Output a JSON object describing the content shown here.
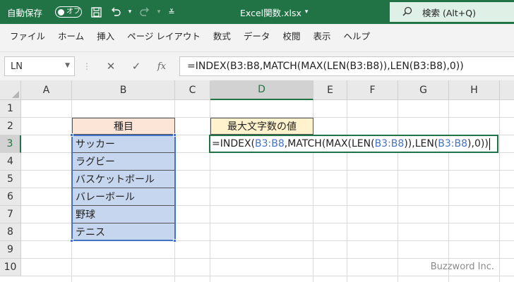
{
  "titlebar": {
    "autosave_label": "自動保存",
    "autosave_state": "オフ",
    "filename": "Excel関数.xlsx",
    "filename_dropdown": "▾",
    "search": "検索 (Alt+Q)"
  },
  "menu": [
    "ファイル",
    "ホーム",
    "挿入",
    "ページ レイアウト",
    "数式",
    "データ",
    "校閲",
    "表示",
    "ヘルプ"
  ],
  "formula_bar": {
    "name_box": "LN",
    "cancel_icon": "✕",
    "enter_icon": "✓",
    "function_icon": "fx",
    "formula": "=INDEX(B3:B8,MATCH(MAX(LEN(B3:B8)),LEN(B3:B8),0))"
  },
  "grid": {
    "columns": [
      "A",
      "B",
      "C",
      "D",
      "E",
      "F",
      "G",
      "H"
    ],
    "rows": [
      "1",
      "2",
      "3",
      "4",
      "5",
      "6",
      "7",
      "8",
      "9",
      "10"
    ],
    "selected_column": "D",
    "selected_row": "3",
    "b_header": "種目",
    "d_header": "最大文字数の値",
    "items": [
      "サッカー",
      "ラグビー",
      "バスケットボール",
      "バレーボール",
      "野球",
      "テニス"
    ],
    "edit_parts": {
      "p1": "=INDEX(",
      "r1": "B3:B8",
      "p2": ",MATCH(MAX(LEN(",
      "r2": "B3:B8",
      "p3": ")),LEN(",
      "r3": "B3:B8",
      "p4": "),0))"
    }
  },
  "watermark": "Buzzword Inc."
}
